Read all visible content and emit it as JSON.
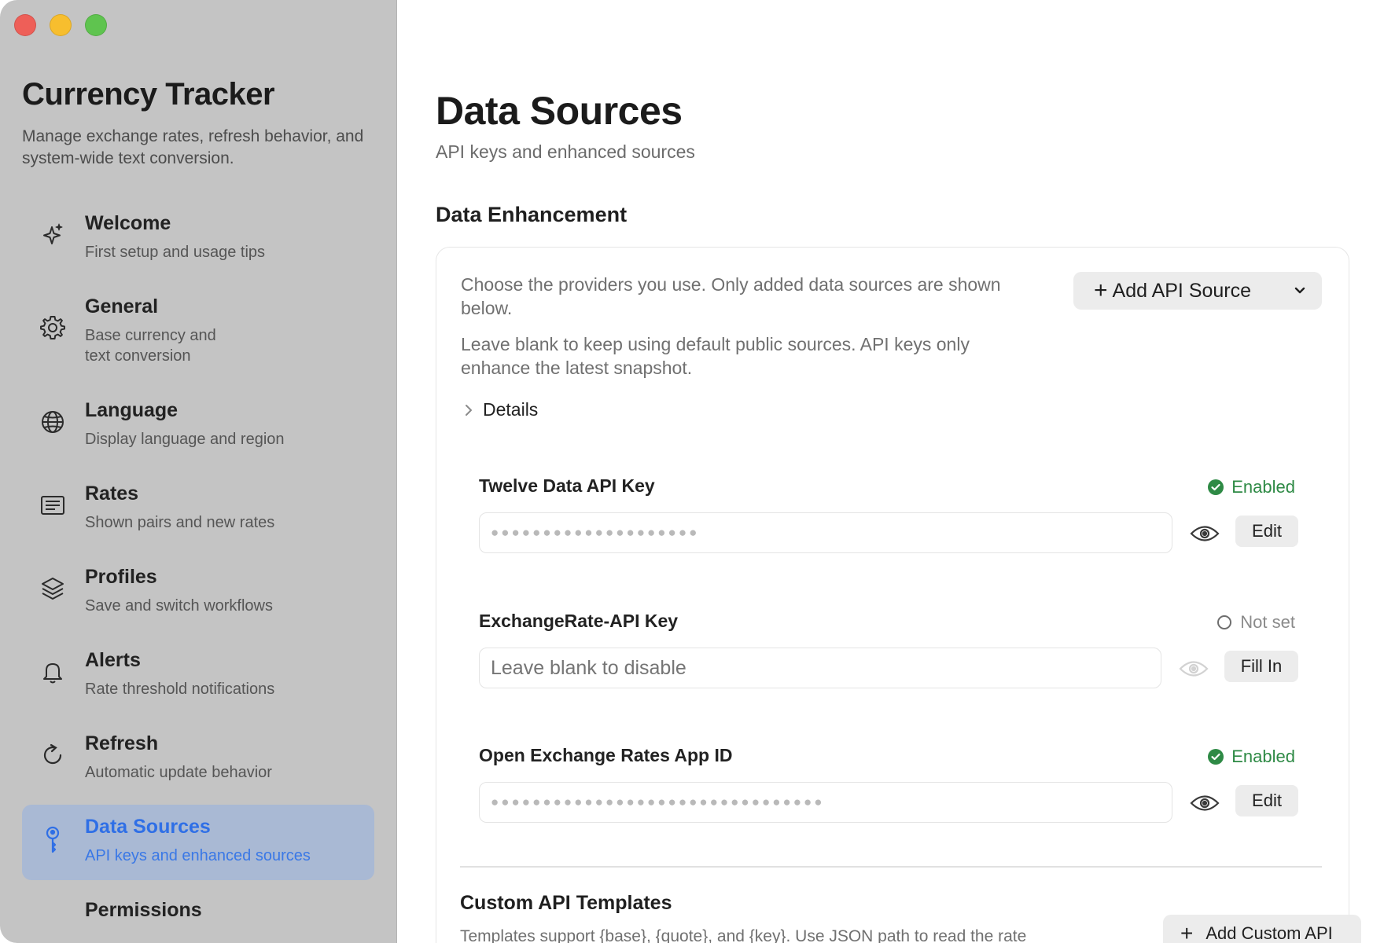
{
  "app": {
    "title": "Currency Tracker",
    "subtitle": "Manage exchange rates, refresh behavior, and system-wide text conversion."
  },
  "sidebar": {
    "items": [
      {
        "label": "Welcome",
        "desc": "First setup and usage tips",
        "icon": "sparkles-icon"
      },
      {
        "label": "General",
        "desc": "Base currency and text conversion",
        "icon": "gear-icon"
      },
      {
        "label": "Language",
        "desc": "Display language and region",
        "icon": "globe-icon"
      },
      {
        "label": "Rates",
        "desc": "Shown pairs and new rates",
        "icon": "list-icon"
      },
      {
        "label": "Profiles",
        "desc": "Save and switch workflows",
        "icon": "layers-icon"
      },
      {
        "label": "Alerts",
        "desc": "Rate threshold notifications",
        "icon": "bell-icon"
      },
      {
        "label": "Refresh",
        "desc": "Automatic update behavior",
        "icon": "refresh-icon"
      },
      {
        "label": "Data Sources",
        "desc": "API keys and enhanced sources",
        "icon": "key-icon",
        "active": true
      },
      {
        "label": "Permissions",
        "desc": "",
        "icon": "lock-icon"
      }
    ]
  },
  "main": {
    "title": "Data Sources",
    "subtitle": "API keys and enhanced sources",
    "section_title": "Data Enhancement",
    "intro_1": "Choose the providers you use. Only added data sources are shown below.",
    "intro_2": "Leave blank to keep using default public sources. API keys only enhance the latest snapshot.",
    "add_api_label": "Add API Source",
    "details_label": "Details",
    "fields": [
      {
        "label": "Twelve Data API Key",
        "status": "Enabled",
        "value": "●●●●●●●●●●●●●●●●●●●●",
        "button": "Edit"
      },
      {
        "label": "ExchangeRate-API Key",
        "status": "Not set",
        "placeholder": "Leave blank to disable",
        "button": "Fill In"
      },
      {
        "label": "Open Exchange Rates App ID",
        "status": "Enabled",
        "value": "●●●●●●●●●●●●●●●●●●●●●●●●●●●●●●●●",
        "button": "Edit"
      }
    ],
    "custom_title": "Custom API Templates",
    "custom_desc": "Templates support {base}, {quote}, and {key}. Use JSON path to read the rate",
    "add_custom_label": "Add Custom API"
  },
  "colors": {
    "accent": "#2f6fe6",
    "enabled": "#2e8a45",
    "sidebar_bg": "#c4c4c4",
    "active_bg": "#a9b9d4"
  }
}
